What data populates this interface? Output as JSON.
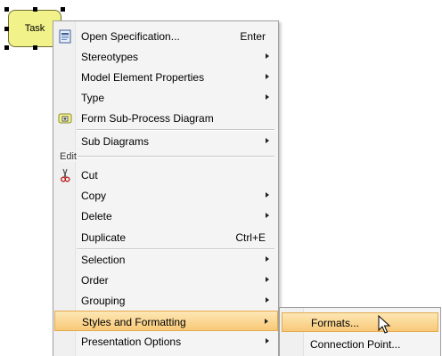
{
  "diagram": {
    "task_label": "Task"
  },
  "menu": {
    "items": [
      {
        "label": "Open Specification...",
        "shortcut": "Enter",
        "icon": "open-specification-icon"
      },
      {
        "label": "Stereotypes"
      },
      {
        "label": "Model Element Properties"
      },
      {
        "label": "Type"
      },
      {
        "label": "Form Sub-Process Diagram",
        "icon": "subprocess-diagram-icon"
      },
      {
        "label": "Sub Diagrams"
      },
      {
        "label": "Cut",
        "icon": "scissors-icon"
      },
      {
        "label": "Copy"
      },
      {
        "label": "Delete"
      },
      {
        "label": "Duplicate",
        "shortcut": "Ctrl+E"
      },
      {
        "label": "Selection"
      },
      {
        "label": "Order"
      },
      {
        "label": "Grouping"
      },
      {
        "label": "Styles and Formatting"
      },
      {
        "label": "Presentation Options"
      }
    ],
    "section_edit": "Edit"
  },
  "submenu": {
    "items": [
      {
        "label": "Formats..."
      },
      {
        "label": "Connection Point..."
      }
    ]
  },
  "colors": {
    "task_fill": "#f2f28a",
    "highlight": "#f8c978"
  }
}
